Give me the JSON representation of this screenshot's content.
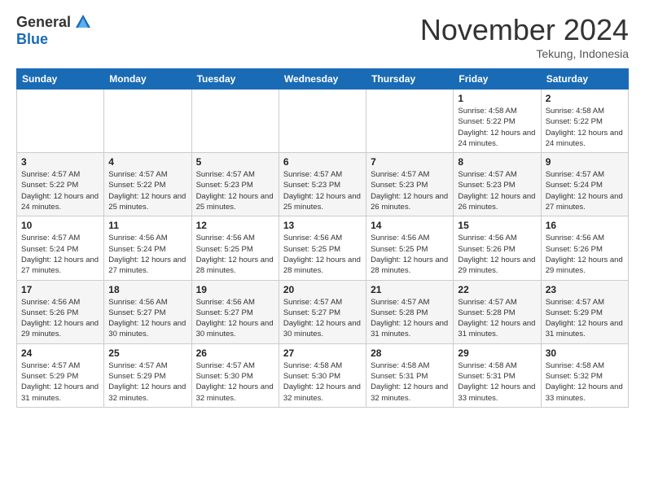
{
  "logo": {
    "general": "General",
    "blue": "Blue"
  },
  "title": "November 2024",
  "subtitle": "Tekung, Indonesia",
  "weekdays": [
    "Sunday",
    "Monday",
    "Tuesday",
    "Wednesday",
    "Thursday",
    "Friday",
    "Saturday"
  ],
  "weeks": [
    [
      {
        "day": "",
        "info": ""
      },
      {
        "day": "",
        "info": ""
      },
      {
        "day": "",
        "info": ""
      },
      {
        "day": "",
        "info": ""
      },
      {
        "day": "",
        "info": ""
      },
      {
        "day": "1",
        "info": "Sunrise: 4:58 AM\nSunset: 5:22 PM\nDaylight: 12 hours\nand 24 minutes."
      },
      {
        "day": "2",
        "info": "Sunrise: 4:58 AM\nSunset: 5:22 PM\nDaylight: 12 hours\nand 24 minutes."
      }
    ],
    [
      {
        "day": "3",
        "info": "Sunrise: 4:57 AM\nSunset: 5:22 PM\nDaylight: 12 hours\nand 24 minutes."
      },
      {
        "day": "4",
        "info": "Sunrise: 4:57 AM\nSunset: 5:22 PM\nDaylight: 12 hours\nand 25 minutes."
      },
      {
        "day": "5",
        "info": "Sunrise: 4:57 AM\nSunset: 5:23 PM\nDaylight: 12 hours\nand 25 minutes."
      },
      {
        "day": "6",
        "info": "Sunrise: 4:57 AM\nSunset: 5:23 PM\nDaylight: 12 hours\nand 25 minutes."
      },
      {
        "day": "7",
        "info": "Sunrise: 4:57 AM\nSunset: 5:23 PM\nDaylight: 12 hours\nand 26 minutes."
      },
      {
        "day": "8",
        "info": "Sunrise: 4:57 AM\nSunset: 5:23 PM\nDaylight: 12 hours\nand 26 minutes."
      },
      {
        "day": "9",
        "info": "Sunrise: 4:57 AM\nSunset: 5:24 PM\nDaylight: 12 hours\nand 27 minutes."
      }
    ],
    [
      {
        "day": "10",
        "info": "Sunrise: 4:57 AM\nSunset: 5:24 PM\nDaylight: 12 hours\nand 27 minutes."
      },
      {
        "day": "11",
        "info": "Sunrise: 4:56 AM\nSunset: 5:24 PM\nDaylight: 12 hours\nand 27 minutes."
      },
      {
        "day": "12",
        "info": "Sunrise: 4:56 AM\nSunset: 5:25 PM\nDaylight: 12 hours\nand 28 minutes."
      },
      {
        "day": "13",
        "info": "Sunrise: 4:56 AM\nSunset: 5:25 PM\nDaylight: 12 hours\nand 28 minutes."
      },
      {
        "day": "14",
        "info": "Sunrise: 4:56 AM\nSunset: 5:25 PM\nDaylight: 12 hours\nand 28 minutes."
      },
      {
        "day": "15",
        "info": "Sunrise: 4:56 AM\nSunset: 5:26 PM\nDaylight: 12 hours\nand 29 minutes."
      },
      {
        "day": "16",
        "info": "Sunrise: 4:56 AM\nSunset: 5:26 PM\nDaylight: 12 hours\nand 29 minutes."
      }
    ],
    [
      {
        "day": "17",
        "info": "Sunrise: 4:56 AM\nSunset: 5:26 PM\nDaylight: 12 hours\nand 29 minutes."
      },
      {
        "day": "18",
        "info": "Sunrise: 4:56 AM\nSunset: 5:27 PM\nDaylight: 12 hours\nand 30 minutes."
      },
      {
        "day": "19",
        "info": "Sunrise: 4:56 AM\nSunset: 5:27 PM\nDaylight: 12 hours\nand 30 minutes."
      },
      {
        "day": "20",
        "info": "Sunrise: 4:57 AM\nSunset: 5:27 PM\nDaylight: 12 hours\nand 30 minutes."
      },
      {
        "day": "21",
        "info": "Sunrise: 4:57 AM\nSunset: 5:28 PM\nDaylight: 12 hours\nand 31 minutes."
      },
      {
        "day": "22",
        "info": "Sunrise: 4:57 AM\nSunset: 5:28 PM\nDaylight: 12 hours\nand 31 minutes."
      },
      {
        "day": "23",
        "info": "Sunrise: 4:57 AM\nSunset: 5:29 PM\nDaylight: 12 hours\nand 31 minutes."
      }
    ],
    [
      {
        "day": "24",
        "info": "Sunrise: 4:57 AM\nSunset: 5:29 PM\nDaylight: 12 hours\nand 31 minutes."
      },
      {
        "day": "25",
        "info": "Sunrise: 4:57 AM\nSunset: 5:29 PM\nDaylight: 12 hours\nand 32 minutes."
      },
      {
        "day": "26",
        "info": "Sunrise: 4:57 AM\nSunset: 5:30 PM\nDaylight: 12 hours\nand 32 minutes."
      },
      {
        "day": "27",
        "info": "Sunrise: 4:58 AM\nSunset: 5:30 PM\nDaylight: 12 hours\nand 32 minutes."
      },
      {
        "day": "28",
        "info": "Sunrise: 4:58 AM\nSunset: 5:31 PM\nDaylight: 12 hours\nand 32 minutes."
      },
      {
        "day": "29",
        "info": "Sunrise: 4:58 AM\nSunset: 5:31 PM\nDaylight: 12 hours\nand 33 minutes."
      },
      {
        "day": "30",
        "info": "Sunrise: 4:58 AM\nSunset: 5:32 PM\nDaylight: 12 hours\nand 33 minutes."
      }
    ]
  ]
}
